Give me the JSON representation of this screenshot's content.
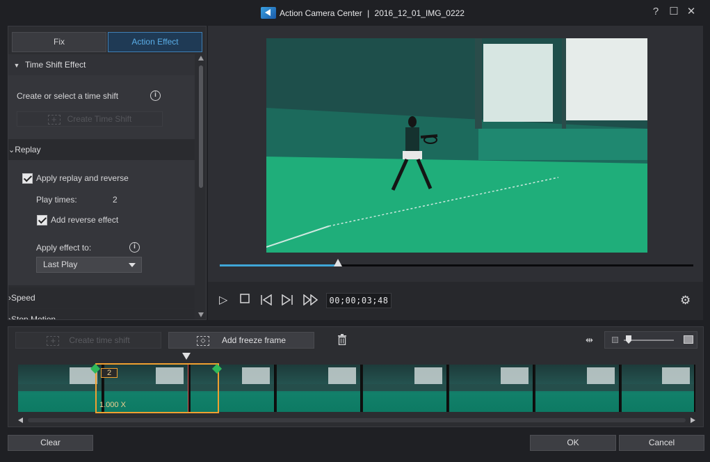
{
  "window": {
    "app_name": "Action Camera Center",
    "separator": "|",
    "file_name": "2016_12_01_IMG_0222",
    "help_label": "?",
    "maximize_label": "☐",
    "close_label": "✕"
  },
  "tabs": [
    {
      "label": "Fix",
      "active": false
    },
    {
      "label": "Action Effect",
      "active": true
    }
  ],
  "time_shift": {
    "header": "Time Shift Effect",
    "prompt": "Create or select a time shift",
    "create_button": "Create Time Shift"
  },
  "replay": {
    "header": "Replay",
    "apply_label": "Apply replay and reverse",
    "apply_checked": true,
    "play_times_label": "Play times:",
    "play_times_value": "2",
    "reverse_label": "Add reverse effect",
    "reverse_checked": true,
    "apply_to_label": "Apply effect to:",
    "apply_to_value": "Last Play"
  },
  "speed": {
    "header": "Speed"
  },
  "stop_motion": {
    "header": "Stop Motion"
  },
  "player": {
    "timecode": "00;00;03;48",
    "progress_fraction": 0.25,
    "accent_color": "#3fa6d8"
  },
  "timeline": {
    "create_shift_label": "Create time shift",
    "freeze_label": "Add freeze frame",
    "speed_label": "1.000 X",
    "count_badge": "2"
  },
  "footer": {
    "clear_label": "Clear",
    "ok_label": "OK",
    "cancel_label": "Cancel"
  }
}
